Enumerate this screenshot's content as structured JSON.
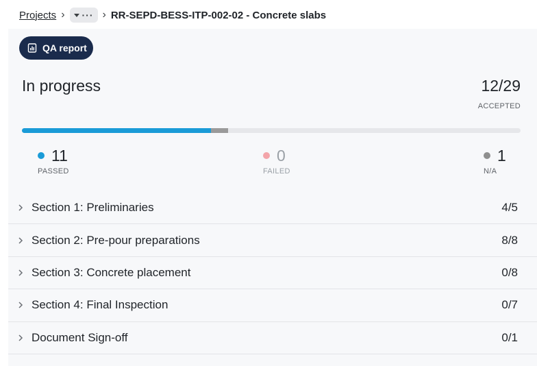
{
  "breadcrumb": {
    "root": "Projects",
    "current": "RR-SEPD-BESS-ITP-002-02 - Concrete slabs"
  },
  "toolbar": {
    "qa_report_label": "QA report",
    "qa_report_icon": "report-chart-icon"
  },
  "summary": {
    "status": "In progress",
    "accepted_ratio": "12/29",
    "accepted_label": "ACCEPTED",
    "progress": {
      "passed": 11,
      "na": 1,
      "failed": 0,
      "total": 29
    }
  },
  "stats": {
    "passed": {
      "value": "11",
      "label": "PASSED",
      "color": "#1a9bd7"
    },
    "failed": {
      "value": "0",
      "label": "FAILED",
      "color": "#f3a5aa"
    },
    "na": {
      "value": "1",
      "label": "N/A",
      "color": "#8f8f8f"
    }
  },
  "sections": [
    {
      "name": "Section 1: Preliminaries",
      "count": "4/5"
    },
    {
      "name": "Section 2: Pre-pour preparations",
      "count": "8/8"
    },
    {
      "name": "Section 3: Concrete placement",
      "count": "0/8"
    },
    {
      "name": "Section 4: Final Inspection",
      "count": "0/7"
    },
    {
      "name": "Document Sign-off",
      "count": "0/1"
    }
  ],
  "colors": {
    "primary_button": "#1a2b4c",
    "accent": "#1a9bd7"
  }
}
